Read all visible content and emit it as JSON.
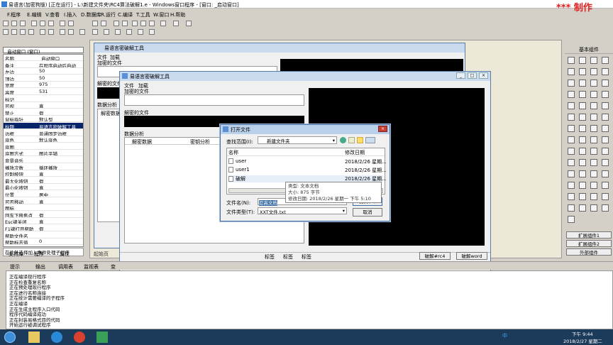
{
  "app": {
    "title": "易语言(加密狗版) [正在运行] - L:\\新建文件夹\\RC4算法破解1.e - Windows窗口程序 - [窗口: _启动窗口]",
    "watermark": "*** 制作"
  },
  "menu": [
    "F.程序",
    "E.编辑",
    "V.查看",
    "I.插入",
    "D.数据库",
    "R.运行",
    "C.编译",
    "T.工具",
    "W.窗口",
    "H.帮助"
  ],
  "left_panel": {
    "selector": "_启动窗口 (窗口)",
    "props": [
      [
        "名称",
        "_启动窗口"
      ],
      [
        "备注",
        "在程序启动后自动"
      ],
      [
        "左边",
        "50"
      ],
      [
        "顶边",
        "50"
      ],
      [
        "宽度",
        "975"
      ],
      [
        "高度",
        "531"
      ],
      [
        "标记",
        ""
      ],
      [
        "可视",
        "真"
      ],
      [
        "禁止",
        "假"
      ],
      [
        "鼠标指针",
        "默认型"
      ],
      [
        "标题",
        "易语言密破解工具"
      ],
      [
        "边框",
        "普通固定边框"
      ],
      [
        "底色",
        "默认底色"
      ],
      [
        "底图",
        ""
      ],
      [
        "底图方式",
        "图片平铺"
      ],
      [
        "背景音乐",
        ""
      ],
      [
        "播放次数",
        "循环播放"
      ],
      [
        "控制按钮",
        "真"
      ],
      [
        "最大化按钮",
        "假"
      ],
      [
        "最小化按钮",
        "真"
      ],
      [
        "位置",
        "居中"
      ],
      [
        "可否移动",
        "真"
      ],
      [
        "图标",
        ""
      ],
      [
        "回车下移焦点",
        "假"
      ],
      [
        "Esc键关闭",
        "真"
      ],
      [
        "F1键打开帮助",
        "假"
      ],
      [
        "帮助文件名",
        ""
      ],
      [
        "帮助标志值",
        "0"
      ]
    ],
    "selected_index": 10,
    "hint": "在此处选择加入事件处理子程序",
    "tabs": [
      "支持库",
      "程序",
      "属性"
    ]
  },
  "bg_window": {
    "title": "易语言密破解工具",
    "menu": [
      "文件",
      "加载"
    ],
    "label1": "加密的文件",
    "label2": "解密的文件",
    "label3": "数据分析",
    "col1": "解密数据",
    "col2": "密"
  },
  "main_window": {
    "title": "易语言密破解工具",
    "menu": [
      "文件",
      "加载"
    ],
    "label_enc": "加密的文件",
    "label_dec": "解密的文件",
    "label_analysis": "数据分析",
    "col1": "解密数据",
    "col2": "密钥分析",
    "tag1": "标签",
    "tag2": "标签",
    "tag3": "标签",
    "btn_rc4": "破解#rc4",
    "btn_word": "破解word",
    "start_tab": "起始页"
  },
  "dialog": {
    "title": "打开文件",
    "lookin_label": "查找范围(I):",
    "lookin_value": "新建文件夹",
    "col_name": "名称",
    "col_date": "修改日期",
    "files": [
      [
        "user",
        "2018/2/26 星期..."
      ],
      [
        "user1",
        "2018/2/26 星期..."
      ],
      [
        "破解",
        "2018/2/26 星期..."
      ]
    ],
    "filename_label": "文件名(N):",
    "filename_value": "忍高文档",
    "filetype_label": "文件类型(T):",
    "filetype_value": "XXT文件.txt",
    "open_btn": "打开(O)",
    "cancel_btn": "取消",
    "tooltip": [
      "类型: 文本文档",
      "大小: 875 字节",
      "修改日期: 2018/2/26 星期一 下午 5:10"
    ]
  },
  "right_panel": {
    "title": "基本组件",
    "expand1": "扩展组件1",
    "expand2": "扩展组件2",
    "external": "外部组件"
  },
  "output_tabs": [
    "提示",
    "输出",
    "调用表",
    "监视表",
    "变"
  ],
  "output_lines": [
    "正在编译现行程序",
    "正在检查重复名称",
    "正在预处理现行程序",
    "正在进行名称连接",
    "正在统计需要编译的子程序",
    "正在编译",
    "正在生成主程序入口代码",
    "程序代码编译成功",
    "正在封装易格式目的代码",
    "开始运行被调试程序"
  ],
  "taskbar": {
    "time": "下午 9:44",
    "date": "2018/2/27 星期二",
    "ime": "中"
  }
}
